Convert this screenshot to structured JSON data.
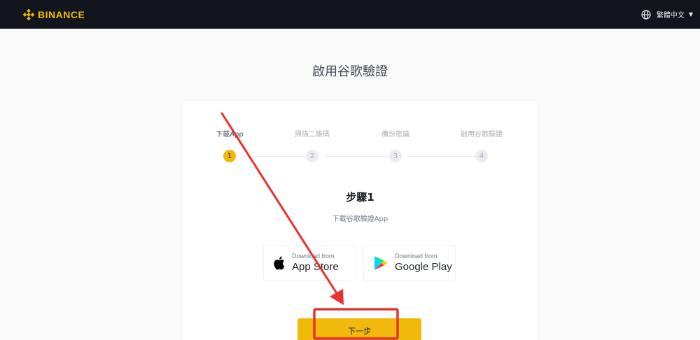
{
  "header": {
    "logo_text": "BINANCE",
    "language": "繁體中文",
    "brand_color": "#f0b90b"
  },
  "page": {
    "title": "啟用谷歌驗證"
  },
  "steps": [
    {
      "label": "下載App",
      "number": "1",
      "active": true
    },
    {
      "label": "掃描二維碼",
      "number": "2",
      "active": false
    },
    {
      "label": "備份密鑰",
      "number": "3",
      "active": false
    },
    {
      "label": "啟用谷歌驗證",
      "number": "4",
      "active": false
    }
  ],
  "content": {
    "heading": "步驟1",
    "subtitle": "下載谷歌驗證App"
  },
  "stores": {
    "app_store": {
      "small": "Download from",
      "big": "App Store",
      "icon": "apple-icon"
    },
    "google_play": {
      "small": "Download from",
      "big": "Google Play",
      "icon": "google-play-icon"
    }
  },
  "actions": {
    "next_label": "下一步"
  },
  "annotation": {
    "color": "#e8322f"
  }
}
